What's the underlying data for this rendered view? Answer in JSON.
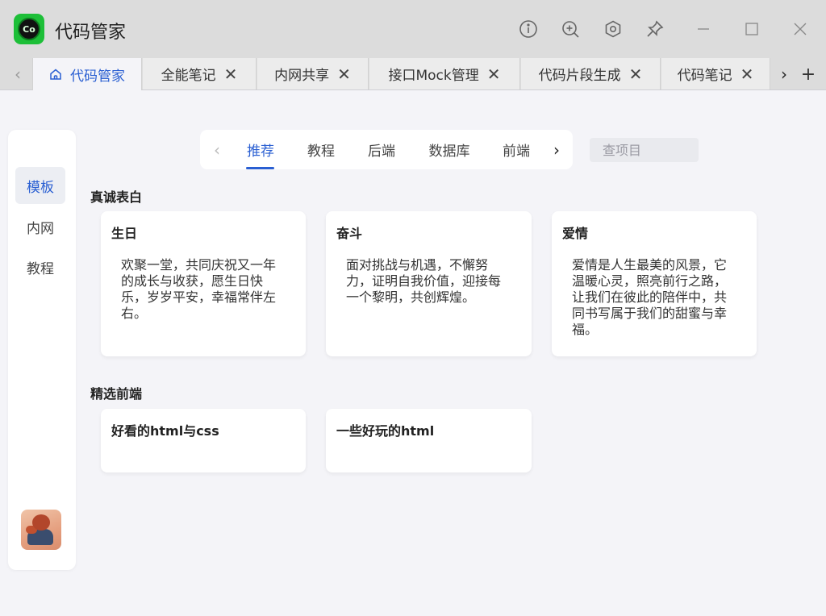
{
  "app": {
    "title": "代码管家",
    "logo_text": "Co"
  },
  "window_controls": {
    "icons": [
      "info-icon",
      "zoom-in-icon",
      "settings-icon",
      "pin-icon",
      "minimize-icon",
      "maximize-icon",
      "close-icon"
    ]
  },
  "tabs": {
    "items": [
      {
        "label": "代码管家",
        "active": true,
        "closable": false
      },
      {
        "label": "全能笔记",
        "active": false,
        "closable": true
      },
      {
        "label": "内网共享",
        "active": false,
        "closable": true
      },
      {
        "label": "接口Mock管理",
        "active": false,
        "closable": true
      },
      {
        "label": "代码片段生成",
        "active": false,
        "closable": true
      },
      {
        "label": "代码笔记",
        "active": false,
        "closable": true
      }
    ],
    "close_glyph": "✕",
    "add_glyph": "+"
  },
  "sidebar": {
    "items": [
      {
        "label": "模板",
        "active": true
      },
      {
        "label": "内网",
        "active": false
      },
      {
        "label": "教程",
        "active": false
      }
    ]
  },
  "categories": {
    "items": [
      {
        "label": "推荐",
        "active": true
      },
      {
        "label": "教程",
        "active": false
      },
      {
        "label": "后端",
        "active": false
      },
      {
        "label": "数据库",
        "active": false
      },
      {
        "label": "前端",
        "active": false
      }
    ]
  },
  "search": {
    "placeholder": "查项目"
  },
  "sections": [
    {
      "title": "真诚表白",
      "cards": [
        {
          "title": "生日",
          "desc": "欢聚一堂，共同庆祝又一年的成长与收获，愿生日快乐，岁岁平安，幸福常伴左右。"
        },
        {
          "title": "奋斗",
          "desc": "面对挑战与机遇，不懈努力，证明自我价值，迎接每一个黎明，共创辉煌。"
        },
        {
          "title": "爱情",
          "desc": "爱情是人生最美的风景，它温暖心灵，照亮前行之路，让我们在彼此的陪伴中，共同书写属于我们的甜蜜与幸福。"
        }
      ]
    },
    {
      "title": "精选前端",
      "cards": [
        {
          "title": "好看的html与css",
          "desc": ""
        },
        {
          "title": "一些好玩的html",
          "desc": ""
        }
      ]
    }
  ],
  "colors": {
    "accent": "#2a5fd2",
    "titlebar": "#dcdcdc",
    "background": "#f4f4f8",
    "logo_green": "#1dbf38"
  }
}
